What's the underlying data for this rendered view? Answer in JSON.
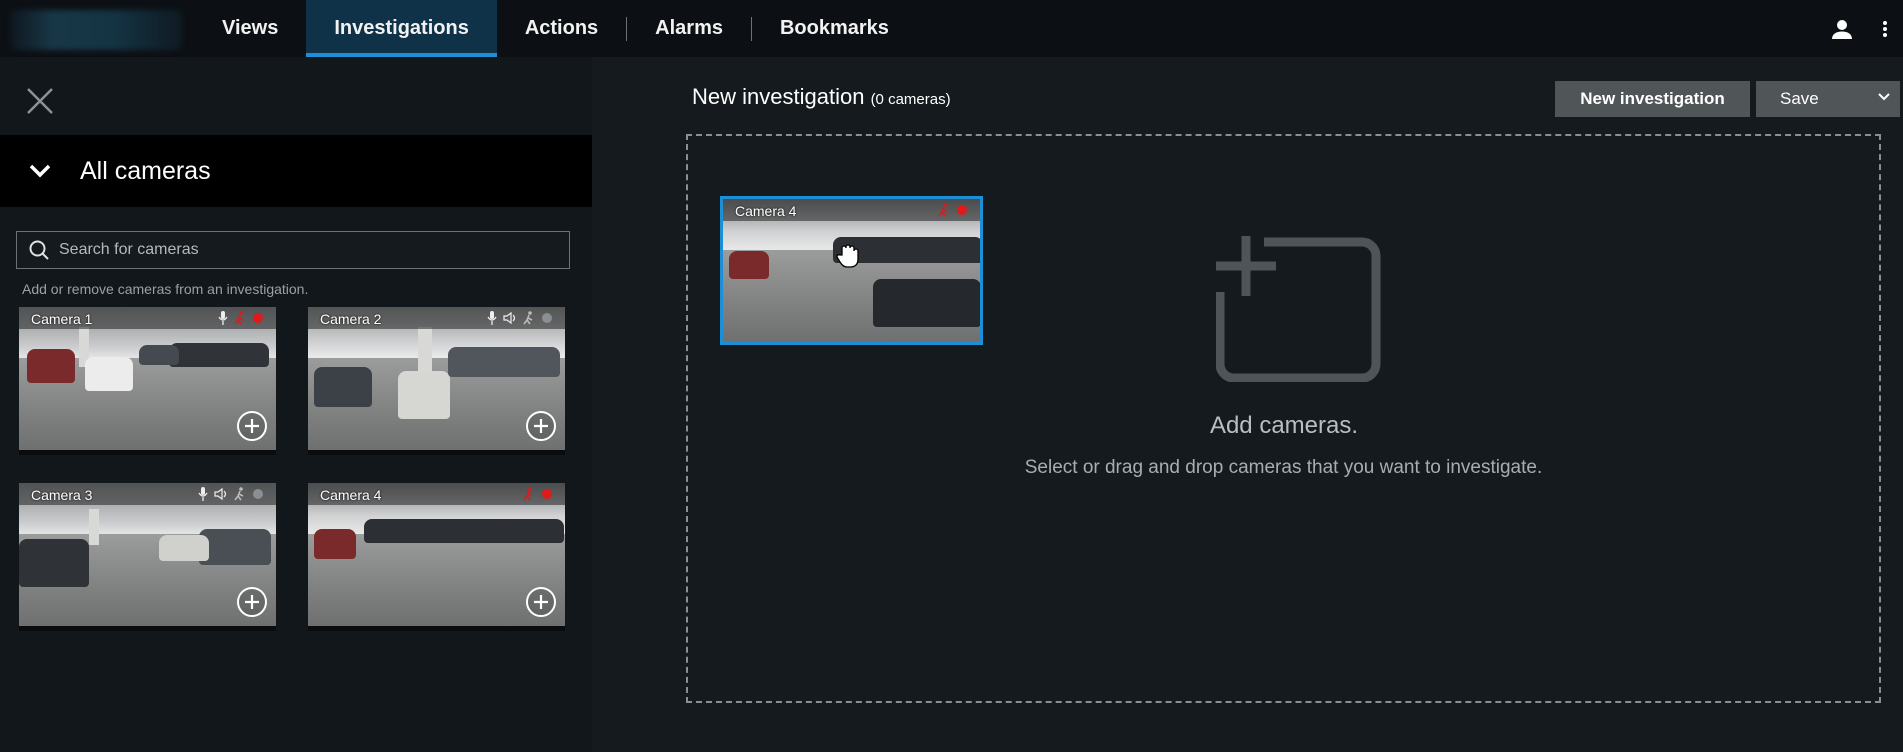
{
  "nav": {
    "items": [
      {
        "label": "Views",
        "active": false
      },
      {
        "label": "Investigations",
        "active": true
      },
      {
        "label": "Actions",
        "active": false
      },
      {
        "label": "Alarms",
        "active": false
      },
      {
        "label": "Bookmarks",
        "active": false
      }
    ],
    "icons": [
      "user-icon",
      "more-vertical-icon"
    ]
  },
  "left_panel": {
    "group_title": "All cameras",
    "search": {
      "placeholder": "Search for cameras",
      "value": ""
    },
    "hint": "Add or remove cameras from an investigation.",
    "cameras": [
      {
        "name": "Camera 1",
        "status_icons": [
          "microphone-icon",
          "motion-icon",
          "recording-dot-icon"
        ],
        "recording": true
      },
      {
        "name": "Camera 2",
        "status_icons": [
          "microphone-icon",
          "speaker-icon",
          "motion-icon",
          "recording-dot-icon"
        ],
        "recording": false
      },
      {
        "name": "Camera 3",
        "status_icons": [
          "microphone-icon",
          "speaker-icon",
          "motion-icon",
          "recording-dot-icon"
        ],
        "recording": false
      },
      {
        "name": "Camera 4",
        "status_icons": [
          "motion-icon",
          "recording-dot-icon"
        ],
        "recording": true
      }
    ]
  },
  "investigation": {
    "title": "New investigation",
    "count": "(0 cameras)",
    "new_button": "New investigation",
    "save_button": "Save",
    "drop_title": "Add cameras.",
    "drop_subtitle": "Select or drag and drop cameras that you want to investigate.",
    "dragging_camera": "Camera 4"
  },
  "colors": {
    "accent": "#1c8fd6",
    "recording": "#e0191b",
    "motion": "#e0191b",
    "idle_dot": "#8a8f93"
  }
}
